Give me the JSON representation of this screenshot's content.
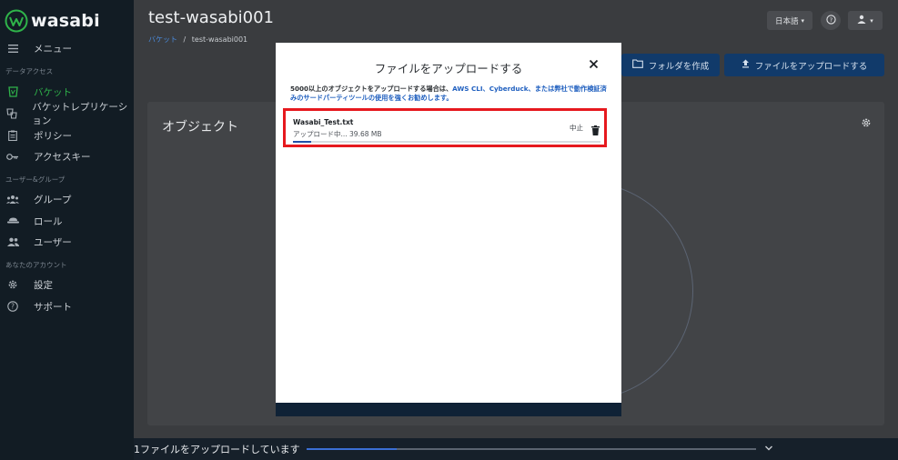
{
  "app": {
    "logo_text": "wasabi"
  },
  "sidebar": {
    "menu": "メニュー",
    "sections": {
      "data_access": "データアクセス",
      "users_groups": "ユーザー&グループ",
      "account": "あなたのアカウント"
    },
    "items": [
      {
        "label": "バケット",
        "icon": "bucket-icon",
        "active": true
      },
      {
        "label": "バケットレプリケーション",
        "icon": "replication-icon"
      },
      {
        "label": "ポリシー",
        "icon": "policy-icon"
      },
      {
        "label": "アクセスキー",
        "icon": "key-icon"
      },
      {
        "label": "グループ",
        "icon": "group-icon"
      },
      {
        "label": "ロール",
        "icon": "role-icon"
      },
      {
        "label": "ユーザー",
        "icon": "users-icon"
      },
      {
        "label": "設定",
        "icon": "gear-icon"
      },
      {
        "label": "サポート",
        "icon": "help-icon"
      }
    ]
  },
  "header": {
    "title": "test-wasabi001",
    "breadcrumb": {
      "root": "バケット",
      "separator": "/",
      "current": "test-wasabi001"
    },
    "language": "日本語",
    "language_caret": "▾",
    "user_caret": "▾"
  },
  "actions": {
    "create_folder": "フォルダを作成",
    "upload_files": "ファイルをアップロードする"
  },
  "card": {
    "title": "オブジェクト"
  },
  "modal": {
    "title": "ファイルをアップロードする",
    "notice_prefix": "5000以上のオブジェクトをアップロードする場合は、",
    "notice_links": "AWS CLI、Cyberduck、または弊社で動作検証済みのサードパーティツールの使用を強くお勧めします。",
    "file": {
      "name": "Wasabi_Test.txt",
      "status": "アップロード中... 39.68 MB",
      "cancel": "中止",
      "progress": 0.06
    }
  },
  "bottom_bar": {
    "text": "1ファイルをアップロードしています",
    "progress": 0.2
  },
  "colors": {
    "sidebar_bg": "#121c24",
    "accent_green": "#2fb34a",
    "primary_blue": "#113a6a",
    "highlight_red": "#e6191e",
    "progress_blue": "#1f4fa8"
  }
}
